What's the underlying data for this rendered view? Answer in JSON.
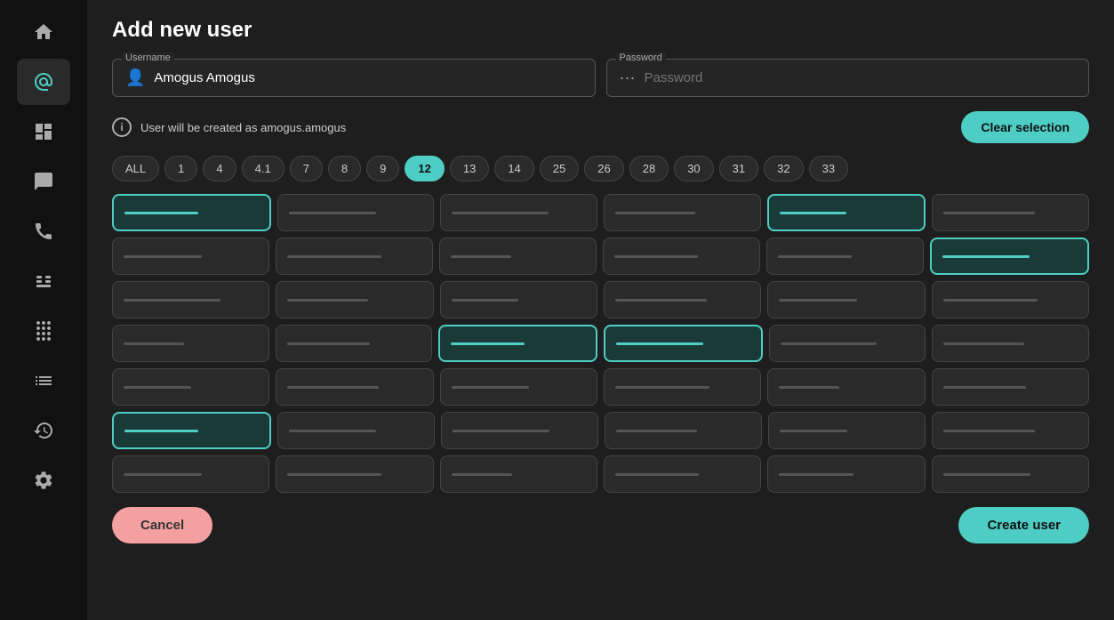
{
  "sidebar": {
    "items": [
      {
        "name": "home",
        "icon": "home",
        "active": false
      },
      {
        "name": "at",
        "icon": "at",
        "active": true
      },
      {
        "name": "dashboard",
        "icon": "dashboard",
        "active": false
      },
      {
        "name": "chat",
        "icon": "chat",
        "active": false
      },
      {
        "name": "phone",
        "icon": "phone",
        "active": false
      },
      {
        "name": "sip",
        "icon": "sip",
        "active": false
      },
      {
        "name": "dialpad",
        "icon": "dialpad",
        "active": false
      },
      {
        "name": "list",
        "icon": "list",
        "active": false
      },
      {
        "name": "history",
        "icon": "history",
        "active": false
      },
      {
        "name": "settings",
        "icon": "settings",
        "active": false
      }
    ]
  },
  "page": {
    "title": "Add new user"
  },
  "username_field": {
    "label": "Username",
    "value": "Amogus Amogus",
    "placeholder": "Username"
  },
  "password_field": {
    "label": "Password",
    "value": "",
    "placeholder": "Password"
  },
  "info_text": "User will be created as amogus.amogus",
  "clear_selection_label": "Clear selection",
  "filter_tabs": [
    {
      "label": "ALL",
      "active": false
    },
    {
      "label": "1",
      "active": false
    },
    {
      "label": "4",
      "active": false
    },
    {
      "label": "4.1",
      "active": false
    },
    {
      "label": "7",
      "active": false
    },
    {
      "label": "8",
      "active": false
    },
    {
      "label": "9",
      "active": false
    },
    {
      "label": "12",
      "active": true
    },
    {
      "label": "13",
      "active": false
    },
    {
      "label": "14",
      "active": false
    },
    {
      "label": "25",
      "active": false
    },
    {
      "label": "26",
      "active": false
    },
    {
      "label": "28",
      "active": false
    },
    {
      "label": "30",
      "active": false
    },
    {
      "label": "31",
      "active": false
    },
    {
      "label": "32",
      "active": false
    },
    {
      "label": "33",
      "active": false
    }
  ],
  "grid_rows": [
    [
      true,
      false,
      false,
      false,
      true,
      false
    ],
    [
      false,
      false,
      false,
      false,
      false,
      true
    ],
    [
      false,
      false,
      false,
      false,
      false,
      false
    ],
    [
      false,
      false,
      true,
      true,
      false,
      false
    ],
    [
      false,
      false,
      false,
      false,
      false,
      false
    ],
    [
      true,
      false,
      false,
      false,
      false,
      false
    ],
    [
      false,
      false,
      false,
      false,
      false,
      false
    ]
  ],
  "cancel_label": "Cancel",
  "create_label": "Create user"
}
